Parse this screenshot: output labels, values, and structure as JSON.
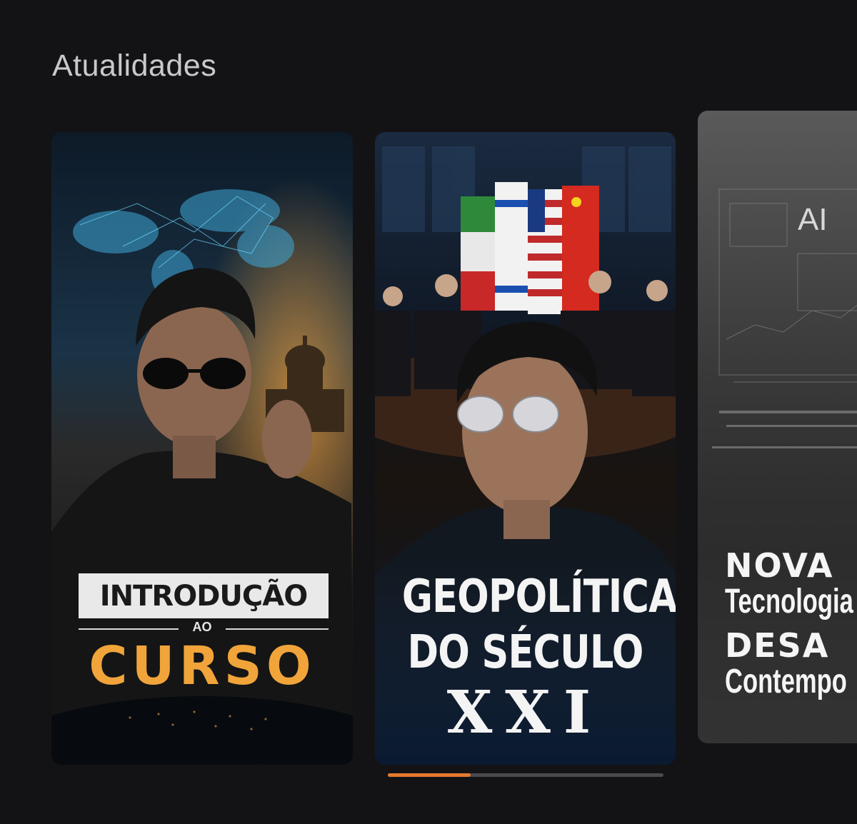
{
  "section": {
    "title": "Atualidades"
  },
  "cards": [
    {
      "title_line1": "INTRODUÇÃO",
      "title_line2": "AO",
      "title_line3": "CURSO"
    },
    {
      "title_line1": "GEOPOLÍTICA",
      "title_line2": "DO SÉCULO",
      "title_line3": "XXI"
    },
    {
      "title_line1": "NOVA",
      "title_line2": "Tecnologia",
      "title_line3": "DESA",
      "title_line4": "Contempo",
      "screen_text": "AI"
    }
  ],
  "carousel": {
    "progress": 0.3,
    "accent_color": "#e47a2e",
    "track_color": "#4a4a4e"
  }
}
